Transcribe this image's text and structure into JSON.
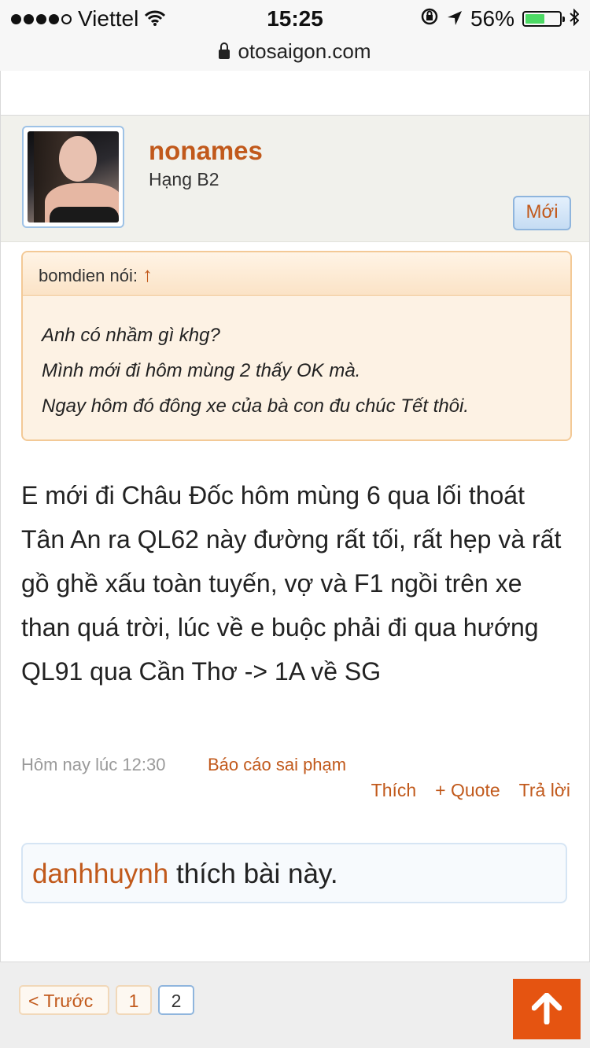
{
  "status_bar": {
    "carrier": "Viettel",
    "time": "15:25",
    "battery_percent": "56%",
    "battery_level": 0.56,
    "signal_bars_filled": 4,
    "signal_bars_total": 5
  },
  "browser": {
    "url": "otosaigon.com"
  },
  "post": {
    "author": "nonames",
    "rank": "Hạng B2",
    "new_badge": "Mới",
    "quote": {
      "attribution": "bomdien nói:",
      "arrow": "↑",
      "lines": [
        "Anh có nhầm gì khg?",
        "Mình mới đi hôm mùng 2 thấy OK mà.",
        "Ngay hôm đó đông xe của bà con đu chúc Tết thôi."
      ]
    },
    "message": "E mới đi Châu Đốc hôm mùng 6 qua lối thoát Tân An ra QL62 này đường rất tối, rất hẹp và rất gồ ghề xấu toàn tuyến, vợ và F1 ngồi trên xe than quá trời, lúc về e buộc phải đi qua hướng QL91 qua Cần Thơ -> 1A về SG",
    "timestamp": "Hôm nay lúc 12:30",
    "report_link": "Báo cáo sai phạm",
    "actions": {
      "like": "Thích",
      "quote": "+ Quote",
      "reply": "Trả lời"
    },
    "likes": {
      "user": "danhhuynh",
      "text": "thích bài này."
    }
  },
  "pagination": {
    "prev": "< Trước",
    "pages": [
      "1",
      "2"
    ],
    "current": "2"
  },
  "colors": {
    "accent": "#c1591b",
    "scroll_top": "#e55411"
  },
  "icons": [
    "wifi-icon",
    "lock-icon",
    "location-arrow-icon",
    "orientation-lock-icon",
    "bluetooth-icon",
    "arrow-up-icon"
  ]
}
